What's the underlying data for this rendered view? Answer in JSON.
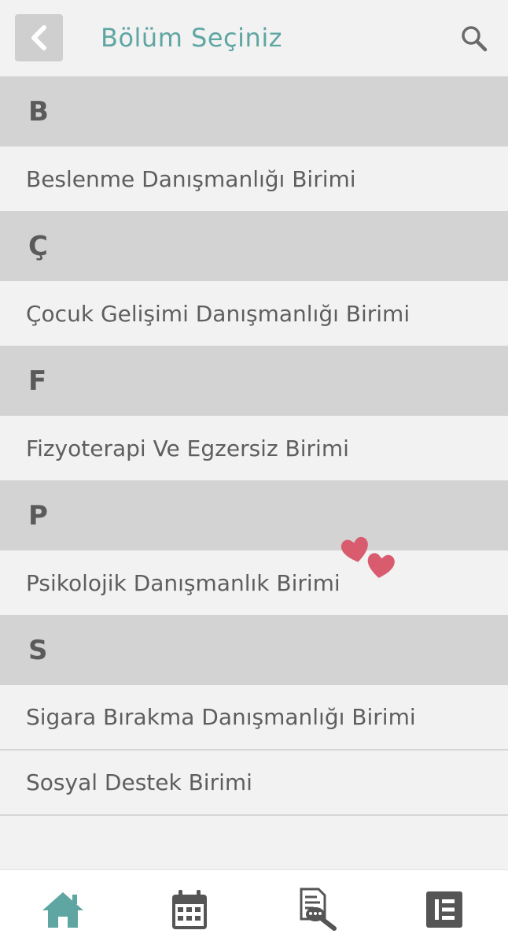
{
  "header": {
    "title": "Bölüm Seçiniz"
  },
  "sections": [
    {
      "letter": "B",
      "items": [
        "Beslenme Danışmanlığı Birimi"
      ]
    },
    {
      "letter": "Ç",
      "items": [
        "Çocuk Gelişimi Danışmanlığı Birimi"
      ]
    },
    {
      "letter": "F",
      "items": [
        "Fizyoterapi Ve Egzersiz Birimi"
      ]
    },
    {
      "letter": "P",
      "items": [
        "Psikolojik Danışmanlık Birimi"
      ]
    },
    {
      "letter": "S",
      "items": [
        "Sigara Bırakma Danışmanlığı Birimi",
        "Sosyal Destek Birimi"
      ]
    }
  ],
  "bottom_nav": {
    "items": [
      "home-icon",
      "calendar-icon",
      "documents-icon",
      "list-icon"
    ],
    "active": "home-icon"
  },
  "colors": {
    "accent": "#5fa6a3",
    "heart": "#d95c6e",
    "icon_gray": "#555555"
  }
}
